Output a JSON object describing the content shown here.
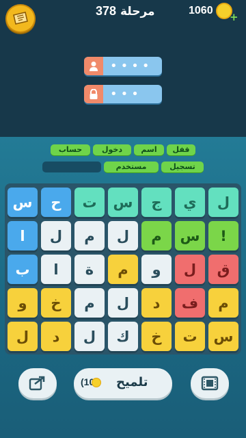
{
  "header": {
    "level_label": "مرحلة",
    "level_number": "378",
    "coins": "1060",
    "coin_plus": "+"
  },
  "login_fields": [
    {
      "icon": "user-icon",
      "mask": "••••"
    },
    {
      "icon": "lock-icon",
      "mask": "•••"
    }
  ],
  "answers": {
    "row1": [
      "قفل",
      "اسم",
      "دخول",
      "حساب"
    ],
    "row2": [
      "تسجيل",
      "مستخدم",
      ""
    ]
  },
  "grid": [
    [
      {
        "l": "ل",
        "c": "#63e0bf"
      },
      {
        "l": "ي",
        "c": "#63e0bf"
      },
      {
        "l": "ج",
        "c": "#63e0bf"
      },
      {
        "l": "س",
        "c": "#63e0bf"
      },
      {
        "l": "ت",
        "c": "#63e0bf"
      },
      {
        "l": "ح",
        "c": "#4aa9ec"
      },
      {
        "l": "س",
        "c": "#4aa9ec"
      }
    ],
    [
      {
        "l": "!",
        "c": "#7bd649"
      },
      {
        "l": "س",
        "c": "#7bd649"
      },
      {
        "l": "م",
        "c": "#7bd649"
      },
      {
        "l": "ل",
        "c": "#eaf1f4"
      },
      {
        "l": "م",
        "c": "#eaf1f4"
      },
      {
        "l": "ل",
        "c": "#eaf1f4"
      },
      {
        "l": "ا",
        "c": "#4aa9ec"
      }
    ],
    [
      {
        "l": "ق",
        "c": "#f06e6e"
      },
      {
        "l": "ل",
        "c": "#f06e6e"
      },
      {
        "l": "و",
        "c": "#eaf1f4"
      },
      {
        "l": "م",
        "c": "#f7d13c"
      },
      {
        "l": "ة",
        "c": "#eaf1f4"
      },
      {
        "l": "ا",
        "c": "#eaf1f4"
      },
      {
        "l": "ب",
        "c": "#4aa9ec"
      }
    ],
    [
      {
        "l": "م",
        "c": "#f7d13c"
      },
      {
        "l": "ف",
        "c": "#f06e6e"
      },
      {
        "l": "د",
        "c": "#f7d13c"
      },
      {
        "l": "ل",
        "c": "#eaf1f4"
      },
      {
        "l": "م",
        "c": "#eaf1f4"
      },
      {
        "l": "خ",
        "c": "#f7d13c"
      },
      {
        "l": "و",
        "c": "#f7d13c"
      }
    ],
    [
      {
        "l": "س",
        "c": "#f7d13c"
      },
      {
        "l": "ت",
        "c": "#f7d13c"
      },
      {
        "l": "خ",
        "c": "#f7d13c"
      },
      {
        "l": "ك",
        "c": "#eaf1f4"
      },
      {
        "l": "ل",
        "c": "#eaf1f4"
      },
      {
        "l": "د",
        "c": "#f7d13c"
      },
      {
        "l": "ل",
        "c": "#f7d13c"
      }
    ]
  ],
  "hint": {
    "label": "تلميح",
    "cost": "(10"
  },
  "colors": {
    "top_bg": "#17384a",
    "board_bg": "#2a5569",
    "answer_chip": "#6fd44a"
  }
}
